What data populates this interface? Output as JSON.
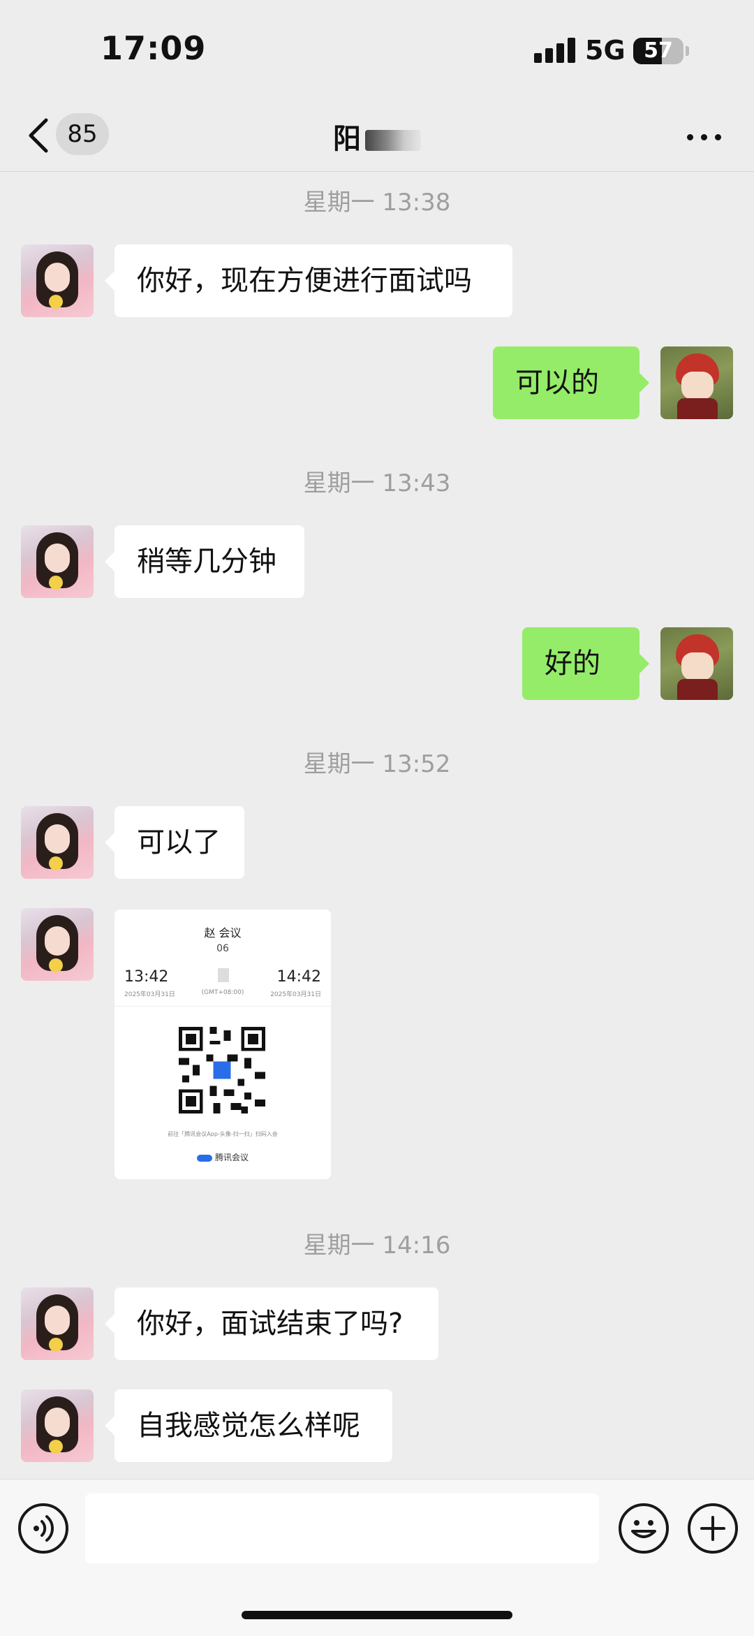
{
  "status_bar": {
    "time": "17:09",
    "network": "5G",
    "battery": "57"
  },
  "nav": {
    "back_badge": "85",
    "title": "阳"
  },
  "messages": {
    "ts1": "星期一 13:38",
    "m1": "你好，现在方便进行面试吗",
    "m2": "可以的",
    "ts2": "星期一 13:43",
    "m3": "稍等几分钟",
    "m4": "好的",
    "ts3": "星期一 13:52",
    "m5": "可以了",
    "ts4": "星期一 14:16",
    "m6": "你好，面试结束了吗?",
    "m7": "自我感觉怎么样呢"
  },
  "meeting_card": {
    "title": "赵      会议",
    "id_fragment": "06",
    "start_time": "13:42",
    "start_date": "2025年03月31日",
    "timezone": "(GMT+08:00)",
    "end_time": "14:42",
    "end_date": "2025年03月31日",
    "tip": "前往「腾讯会议App-头像-扫一扫」扫码入会",
    "brand": "腾讯会议"
  },
  "input_bar": {
    "placeholder": ""
  },
  "icons": [
    "back-icon",
    "more-icon",
    "voice-icon",
    "emoji-icon",
    "plus-icon",
    "qr-code-icon"
  ]
}
